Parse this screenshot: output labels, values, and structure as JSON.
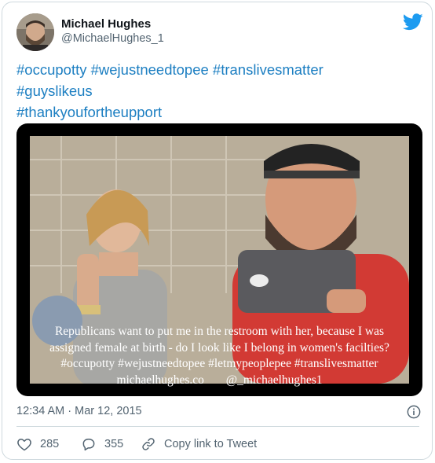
{
  "author": {
    "display_name": "Michael Hughes",
    "handle": "@MichaelHughes_1",
    "avatar_icon": "user-avatar"
  },
  "brand": {
    "icon": "twitter-bird-icon",
    "color": "#1d9bf0"
  },
  "tweet": {
    "lines": [
      "#occupotty #wejustneedtopee #translivesmatter",
      "#guyslikeus",
      "#thankyoufortheupport"
    ],
    "link_color": "#1d7fc2"
  },
  "media": {
    "caption_line1": "Republicans want to put me in the restroom with her, because I was",
    "caption_line2": "assigned female at birth - do I look like I belong in women's facilties?",
    "caption_line3": "#occupotty #wejustneedtopee #letmypeoplepee #translivesmatter",
    "caption_site": "michaelhughes.co",
    "caption_handle": "@_michaelhughes1"
  },
  "timestamp": "12:34 AM · Mar 12, 2015",
  "actions": {
    "like_count": "285",
    "reply_count": "355",
    "copy_link_label": "Copy link to Tweet"
  }
}
